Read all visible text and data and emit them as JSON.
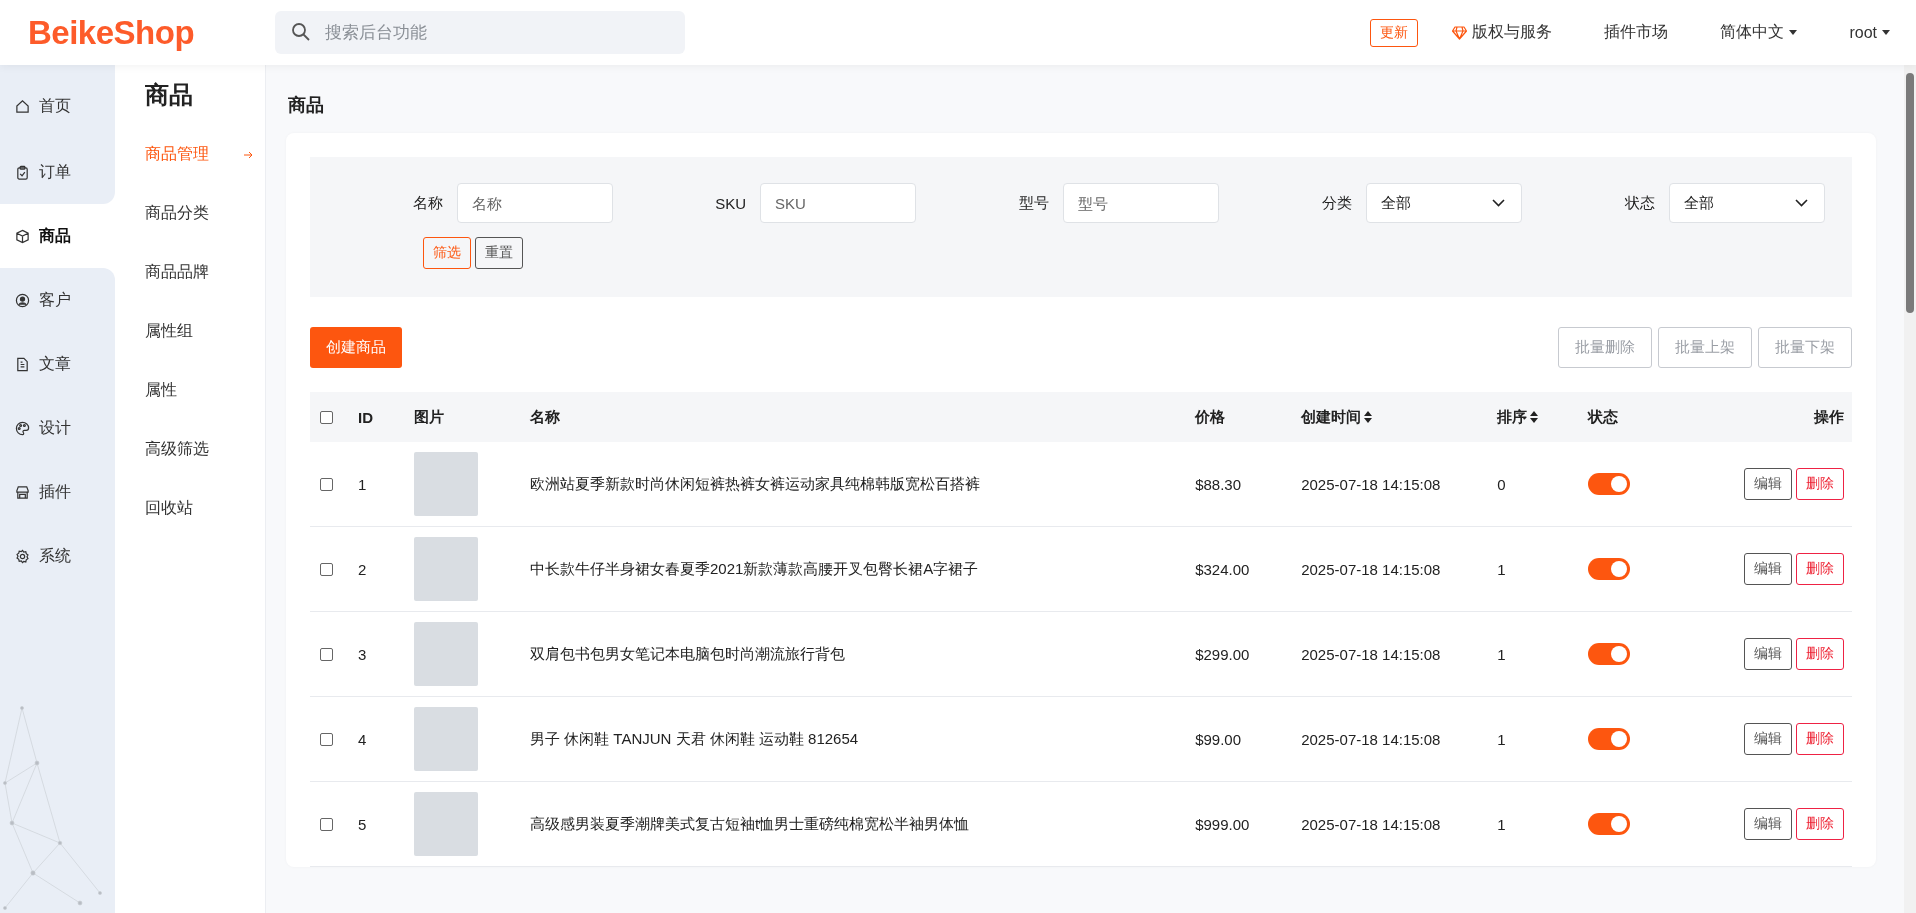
{
  "header": {
    "logo": "BeikeShop",
    "search_placeholder": "搜索后台功能",
    "update_button": "更新",
    "links": [
      {
        "label": "版权与服务",
        "kind": "icon"
      },
      {
        "label": "插件市场",
        "kind": "plain"
      },
      {
        "label": "简体中文",
        "kind": "dropdown"
      },
      {
        "label": "root",
        "kind": "dropdown"
      }
    ]
  },
  "nav": {
    "items": [
      {
        "label": "首页",
        "selected": false
      },
      {
        "label": "订单",
        "selected": false
      },
      {
        "label": "商品",
        "selected": true
      },
      {
        "label": "客户",
        "selected": false
      },
      {
        "label": "文章",
        "selected": false
      },
      {
        "label": "设计",
        "selected": false
      },
      {
        "label": "插件",
        "selected": false
      },
      {
        "label": "系统",
        "selected": false
      }
    ]
  },
  "submenu": {
    "title": "商品",
    "items": [
      {
        "label": "商品管理",
        "selected": true
      },
      {
        "label": "商品分类",
        "selected": false
      },
      {
        "label": "商品品牌",
        "selected": false
      },
      {
        "label": "属性组",
        "selected": false
      },
      {
        "label": "属性",
        "selected": false
      },
      {
        "label": "高级筛选",
        "selected": false
      },
      {
        "label": "回收站",
        "selected": false
      }
    ]
  },
  "page_title": "商品",
  "filters": {
    "fields": [
      {
        "label": "名称",
        "kind": "input",
        "placeholder": "名称"
      },
      {
        "label": "SKU",
        "kind": "input",
        "placeholder": "SKU"
      },
      {
        "label": "型号",
        "kind": "input",
        "placeholder": "型号"
      },
      {
        "label": "分类",
        "kind": "select",
        "value": "全部"
      },
      {
        "label": "状态",
        "kind": "select",
        "value": "全部"
      }
    ],
    "filter_button": "筛选",
    "reset_button": "重置"
  },
  "create_button": "创建商品",
  "bulk_buttons": [
    {
      "label": "批量删除",
      "disabled": true
    },
    {
      "label": "批量上架",
      "disabled": true
    },
    {
      "label": "批量下架",
      "disabled": true
    }
  ],
  "table": {
    "all_checked": false,
    "columns": [
      {
        "label": "ID",
        "sortable": false
      },
      {
        "label": "图片",
        "sortable": false
      },
      {
        "label": "名称",
        "sortable": false
      },
      {
        "label": "价格",
        "sortable": false
      },
      {
        "label": "创建时间",
        "sortable": true
      },
      {
        "label": "排序",
        "sortable": true
      },
      {
        "label": "状态",
        "sortable": false
      },
      {
        "label": "操作",
        "sortable": false
      }
    ],
    "rows": [
      {
        "checked": false,
        "id": "1",
        "name": "欧洲站夏季新款时尚休闲短裤热裤女裤运动家具纯棉韩版宽松百搭裤",
        "price": "$88.30",
        "created": "2025-07-18 14:15:08",
        "sort": "0",
        "on": true,
        "edit": "编辑",
        "delete": "删除"
      },
      {
        "checked": false,
        "id": "2",
        "name": "中长款牛仔半身裙女春夏季2021新款薄款高腰开叉包臀长裙A字裙子",
        "price": "$324.00",
        "created": "2025-07-18 14:15:08",
        "sort": "1",
        "on": true,
        "edit": "编辑",
        "delete": "删除"
      },
      {
        "checked": false,
        "id": "3",
        "name": "双肩包书包男女笔记本电脑包时尚潮流旅行背包",
        "price": "$299.00",
        "created": "2025-07-18 14:15:08",
        "sort": "1",
        "on": true,
        "edit": "编辑",
        "delete": "删除"
      },
      {
        "checked": false,
        "id": "4",
        "name": "男子 休闲鞋 TANJUN 天君 休闲鞋 运动鞋 812654",
        "price": "$99.00",
        "created": "2025-07-18 14:15:08",
        "sort": "1",
        "on": true,
        "edit": "编辑",
        "delete": "删除"
      },
      {
        "checked": false,
        "id": "5",
        "name": "高级感男装夏季潮牌美式复古短袖t恤男士重磅纯棉宽松半袖男体恤",
        "price": "$999.00",
        "created": "2025-07-18 14:15:08",
        "sort": "1",
        "on": true,
        "edit": "编辑",
        "delete": "删除"
      }
    ]
  }
}
